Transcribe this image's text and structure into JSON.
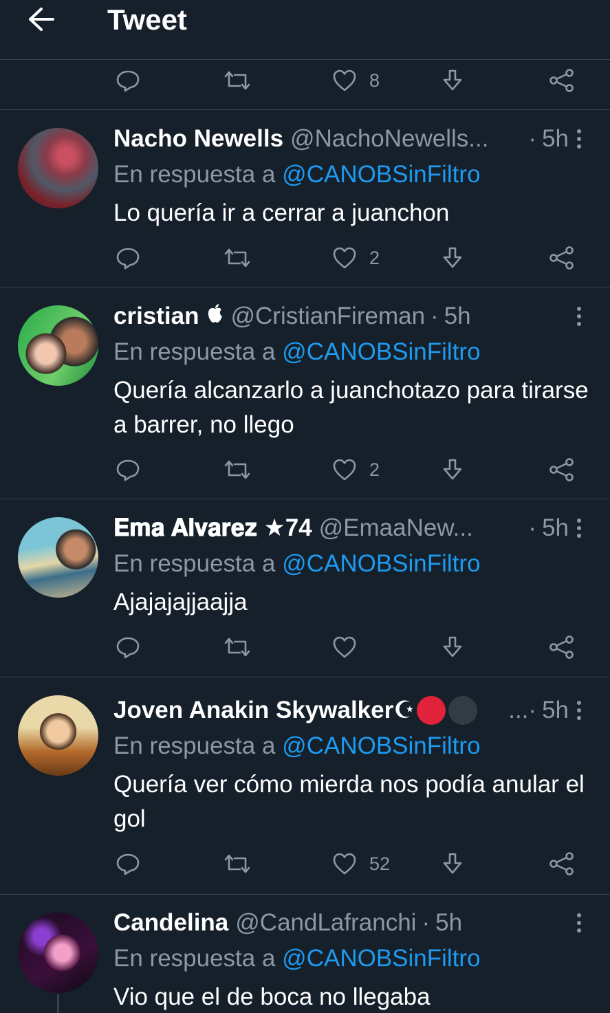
{
  "header": {
    "title": "Tweet"
  },
  "top_actions": {
    "like_count": "8"
  },
  "reply_to_label": "En respuesta a",
  "reply_to_handle": "@CANOBSinFiltro",
  "tweets": [
    {
      "name": "Nacho Newells",
      "handle": "@NachoNewells...",
      "dot": "·",
      "time": "5h",
      "text": "Lo quería ir a cerrar a juanchon",
      "likes": "2"
    },
    {
      "name": "cristian",
      "handle": "@CristianFireman",
      "dot": "·",
      "time": "5h",
      "text": "Quería alcanzarlo a juanchotazo para tirarse a barrer, no llego",
      "likes": "2"
    },
    {
      "name": "𝐄𝐦𝐚 𝐀𝐥𝐯𝐚𝐫𝐞𝐳 ★74",
      "handle": "@EmaaNew...",
      "dot": "·",
      "time": "5h",
      "text": "Ajajajajjaajja",
      "likes": ""
    },
    {
      "name": "Joven Anakin Skywalker☪",
      "handle": "...",
      "dot": "·",
      "time": "5h",
      "text": "Quería ver cómo mierda nos podía anular el gol",
      "likes": "52"
    },
    {
      "name": "Candelina",
      "handle": "@CandLafranchi",
      "dot": "·",
      "time": "5h",
      "text": "Vio que el de boca no llegaba",
      "likes": ""
    }
  ],
  "colors": {
    "background": "#15202b",
    "accent": "#1d9bf0",
    "muted": "#8b98a5",
    "divider": "#38444d",
    "red_dot": "#e0223a"
  }
}
